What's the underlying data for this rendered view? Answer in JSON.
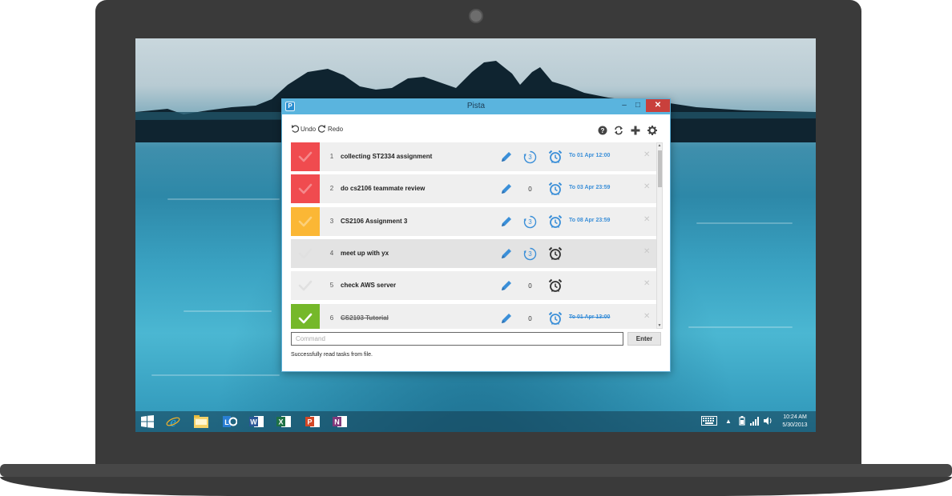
{
  "app": {
    "title": "Pista",
    "icon": "pista-app-icon",
    "window_buttons": {
      "minimize": "–",
      "maximize": "□",
      "close": "✕"
    }
  },
  "toolbar": {
    "undo_label": "Undo",
    "redo_label": "Redo",
    "icons": [
      "help-icon",
      "refresh-icon",
      "add-icon",
      "settings-icon"
    ]
  },
  "tasks": [
    {
      "num": "1",
      "title": "collecting ST2334 assignment",
      "count": "3",
      "count_circled": true,
      "due": "To 01 Apr 12:00",
      "color": "#f04b4f",
      "checked": false,
      "done": false
    },
    {
      "num": "2",
      "title": "do cs2106 teammate review",
      "count": "0",
      "count_circled": false,
      "due": "To 03 Apr 23:59",
      "color": "#f04b4f",
      "checked": false,
      "done": false
    },
    {
      "num": "3",
      "title": "CS2106 Assignment 3",
      "count": "3",
      "count_circled": true,
      "due": "To 08 Apr 23:59",
      "color": "#fbb735",
      "checked": false,
      "done": false
    },
    {
      "num": "4",
      "title": "meet up with yx",
      "count": "3",
      "count_circled": true,
      "due": "",
      "color": "",
      "checked": false,
      "done": false
    },
    {
      "num": "5",
      "title": "check AWS server",
      "count": "0",
      "count_circled": false,
      "due": "",
      "color": "",
      "checked": false,
      "done": false
    },
    {
      "num": "6",
      "title": "CS2103 Tutorial",
      "count": "0",
      "count_circled": false,
      "due": "To 01 Apr 13:00",
      "color": "#75b82a",
      "checked": true,
      "done": true
    }
  ],
  "command": {
    "placeholder": "Command",
    "value": ""
  },
  "enter_label": "Enter",
  "status_text": "Successfully read tasks from file.",
  "taskbar": {
    "apps": [
      "windows-start-icon",
      "internet-explorer-icon",
      "file-explorer-icon",
      "lync-icon",
      "word-icon",
      "excel-icon",
      "powerpoint-icon",
      "onenote-icon"
    ],
    "time": "10:24 AM",
    "date": "5/30/2013"
  },
  "colors": {
    "accent": "#3b8fd8",
    "titlebar": "#5ab4de",
    "close": "#c9403c"
  }
}
